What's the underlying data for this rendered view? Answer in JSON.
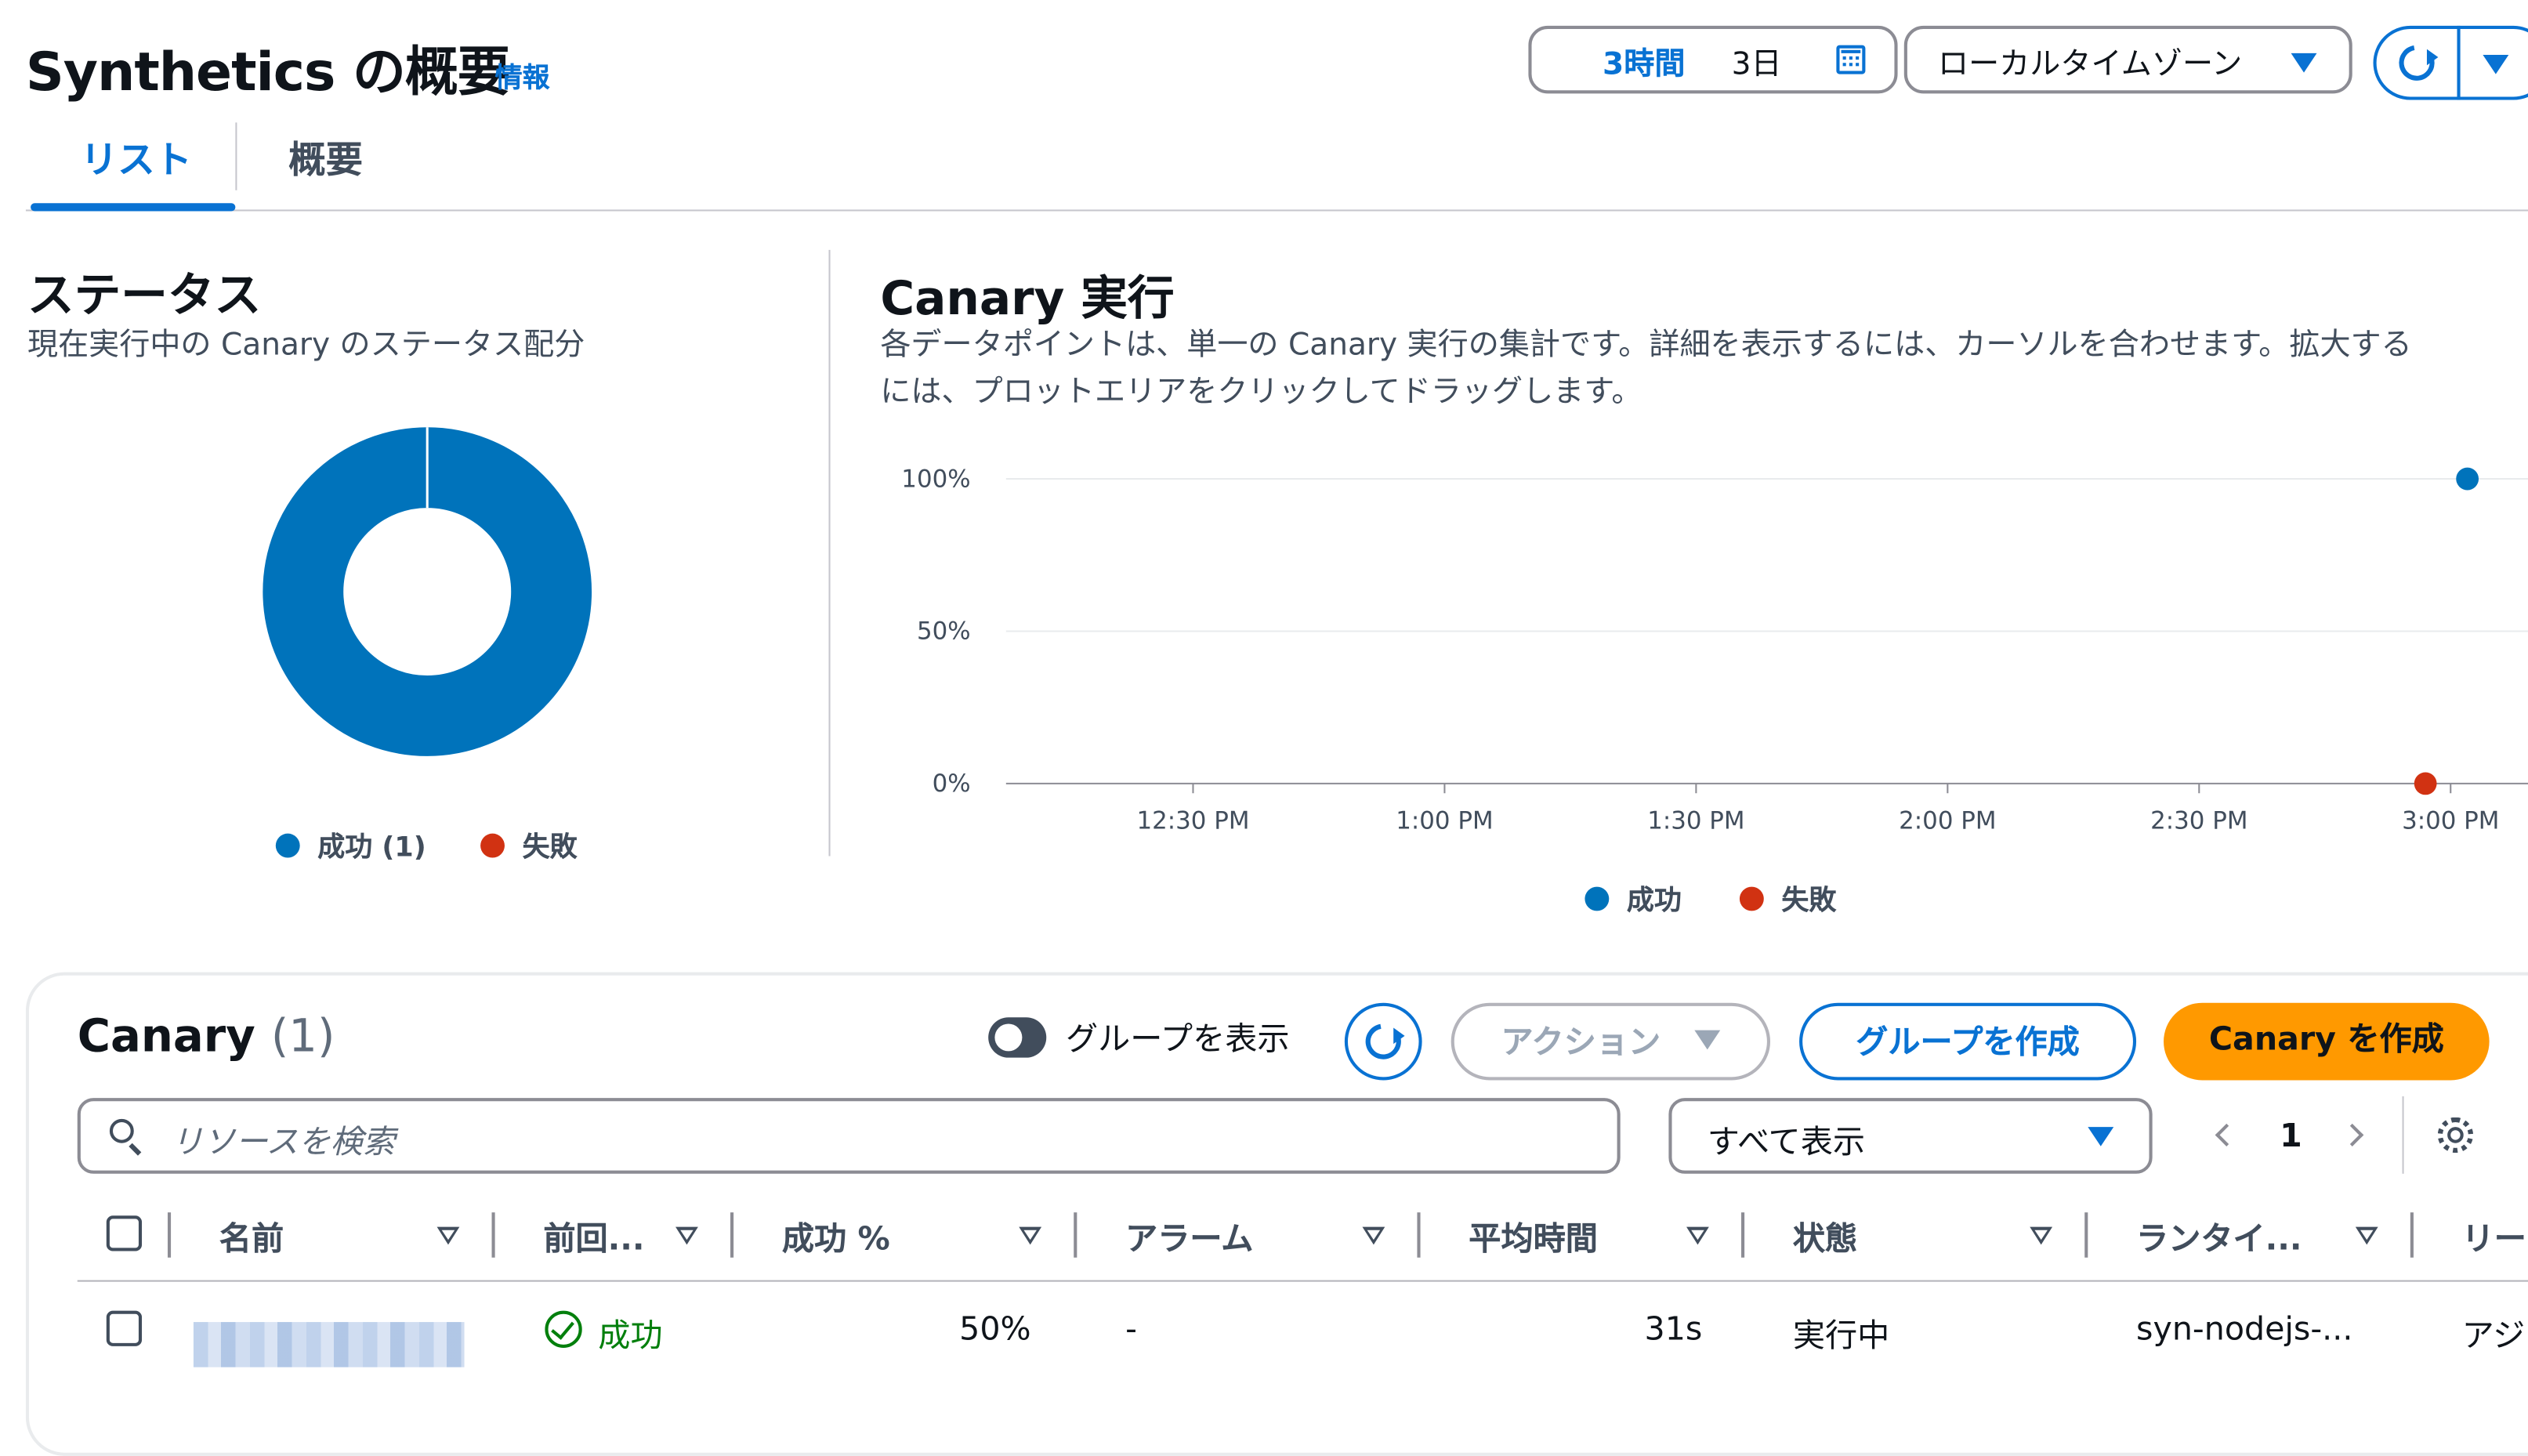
{
  "page": {
    "title": "Synthetics の概要",
    "info_link": "情報",
    "tabs": [
      {
        "label": "リスト",
        "active": true
      },
      {
        "label": "概要",
        "active": false
      }
    ]
  },
  "toolbar": {
    "range_active": "3時間",
    "range_other": "3日",
    "timezone": "ローカルタイムゾーン",
    "calendar_icon": "calendar-icon",
    "refresh_icon": "refresh-icon"
  },
  "status_section": {
    "title": "ステータス",
    "description": "現在実行中の Canary のステータス配分",
    "legend": [
      {
        "label": "成功 (1)",
        "color": "#0073bb"
      },
      {
        "label": "失敗",
        "color": "#d13212"
      }
    ]
  },
  "runs_section": {
    "title": "Canary 実行",
    "description_line1": "各データポイントは、単一の Canary 実行の集計です。詳細を表示するには、カーソルを合わせます。拡大する",
    "description_line2": "には、プロットエリアをクリックしてドラッグします。",
    "legend": [
      {
        "label": "成功",
        "color": "#0073bb"
      },
      {
        "label": "失敗",
        "color": "#d13212"
      }
    ]
  },
  "chart_data": [
    {
      "type": "pie",
      "variant": "donut",
      "labels": [
        "成功",
        "失敗"
      ],
      "values": [
        1,
        0
      ],
      "colors": [
        "#0073bb",
        "#d13212"
      ]
    },
    {
      "type": "scatter",
      "x_ticks": [
        "12:30 PM",
        "1:00 PM",
        "1:30 PM",
        "2:00 PM",
        "2:30 PM",
        "3:00 PM"
      ],
      "y_ticks": [
        "100%",
        "50%",
        "0%"
      ],
      "ylim": [
        0,
        100
      ],
      "series": [
        {
          "name": "成功",
          "color": "#0073bb",
          "points": [
            {
              "x": "3:02 PM",
              "y": 100
            }
          ]
        },
        {
          "name": "失敗",
          "color": "#d13212",
          "points": [
            {
              "x": "2:57 PM",
              "y": 0
            }
          ]
        }
      ]
    }
  ],
  "canary_panel": {
    "title": "Canary",
    "count": "(1)",
    "toggle_label": "グループを表示",
    "actions_button": "アクション",
    "create_group_button": "グループを作成",
    "create_canary_button": "Canary を作成",
    "search_placeholder": "リソースを検索",
    "filter_value": "すべて表示",
    "page_number": "1",
    "columns": [
      "名前",
      "前回...",
      "成功 %",
      "アラーム",
      "平均時間",
      "状態",
      "ランタイ...",
      "リー"
    ],
    "rows": [
      {
        "name": "",
        "last_run": "成功",
        "success_pct": "50%",
        "alarm": "-",
        "avg_duration": "31s",
        "state": "実行中",
        "runtime": "syn-nodejs-...",
        "region": "アジ"
      }
    ]
  }
}
